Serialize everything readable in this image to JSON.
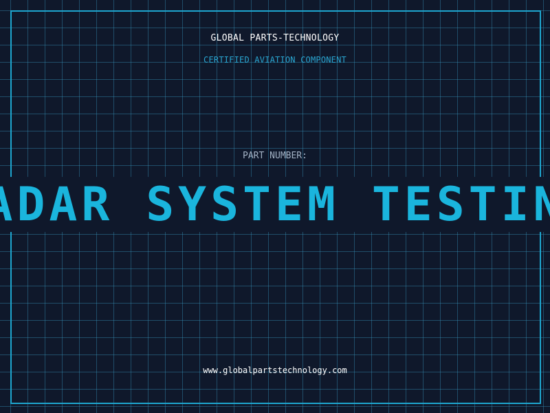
{
  "header": {
    "company": "GLOBAL PARTS-TECHNOLOGY",
    "tagline": "CERTIFIED AVIATION COMPONENT"
  },
  "part": {
    "label": "PART NUMBER:",
    "value": "ADAR SYSTEM TESTIN"
  },
  "footer": {
    "website": "www.globalpartstechnology.com"
  },
  "colors": {
    "background": "#0f182b",
    "grid": "#2f7fa3",
    "accent": "#1ab5dd",
    "frame": "#1ea6cf"
  }
}
